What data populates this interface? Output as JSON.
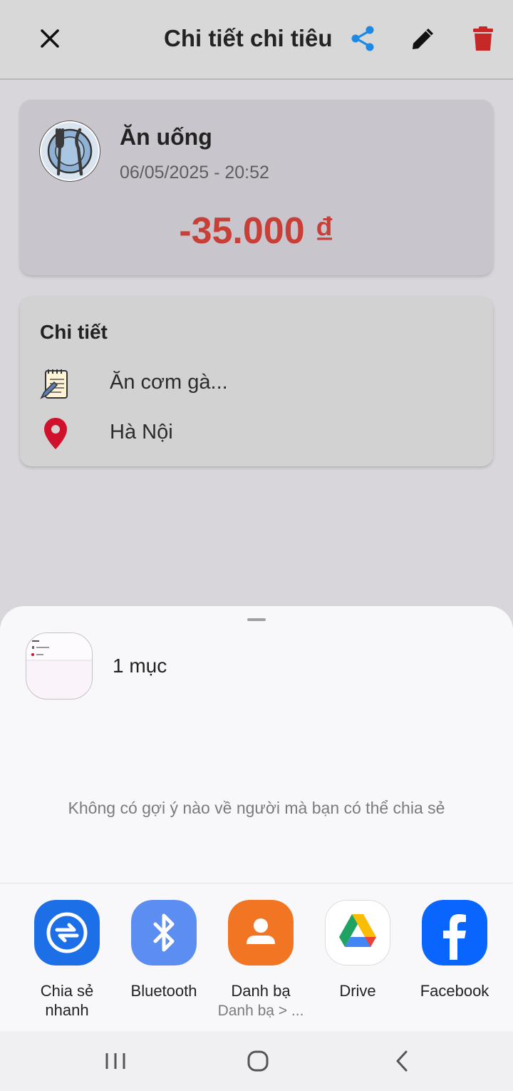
{
  "app": {
    "title": "Chi tiết chi tiêu",
    "summary": {
      "category": "Ăn uống",
      "datetime": "06/05/2025 - 20:52",
      "amount": "-35.000 ₫"
    },
    "detail": {
      "heading": "Chi tiết",
      "note": "Ăn cơm gà...",
      "location": "Hà Nội"
    },
    "colors": {
      "accent": "#1e88e5",
      "expense": "#c73f36",
      "delete": "#c62828"
    }
  },
  "share_sheet": {
    "item_count": "1 mục",
    "no_suggestions": "Không có gợi ý nào về người mà bạn có thể chia sẻ",
    "apps": [
      {
        "label": "Chia sẻ nhanh",
        "icon": "quick-share-icon"
      },
      {
        "label": "Bluetooth",
        "icon": "bluetooth-icon"
      },
      {
        "label": "Danh bạ",
        "sub": "Danh bạ > ...",
        "icon": "contacts-icon"
      },
      {
        "label": "Drive",
        "icon": "drive-icon"
      },
      {
        "label": "Facebook",
        "icon": "facebook-icon"
      }
    ]
  },
  "nav": {
    "recents": "recents-icon",
    "home": "home-icon",
    "back": "back-icon"
  }
}
